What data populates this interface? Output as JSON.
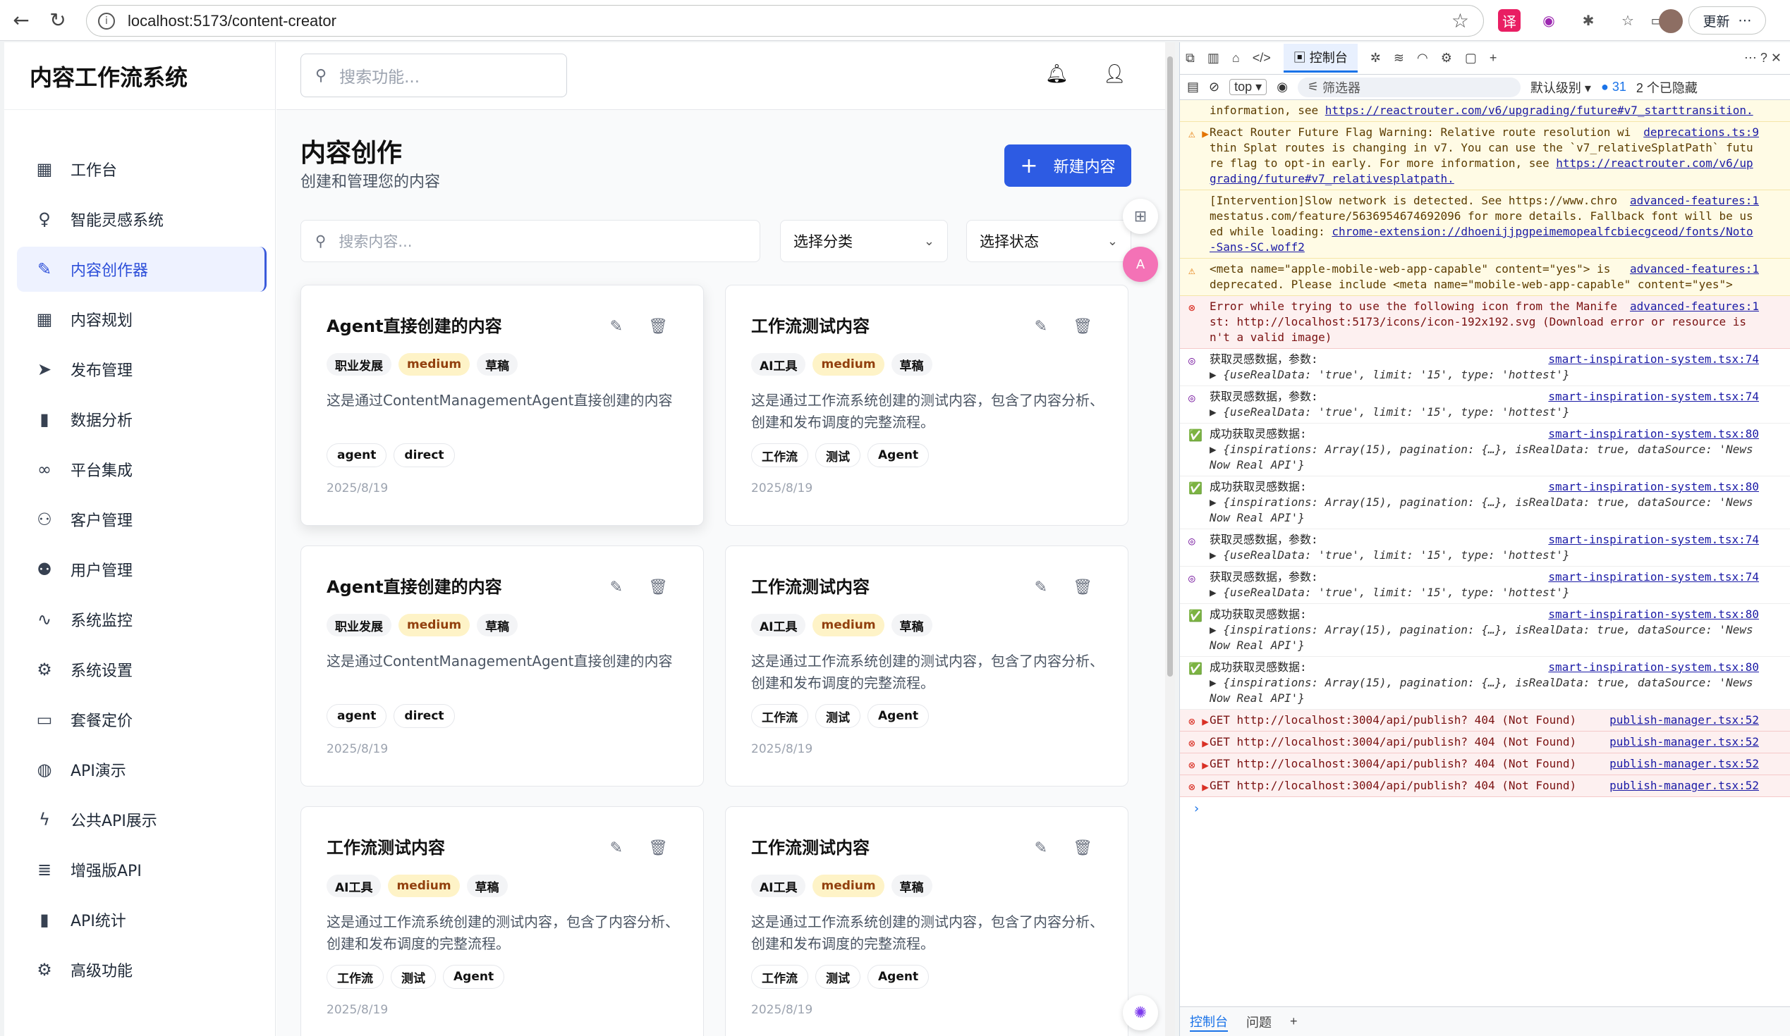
{
  "browser": {
    "url": "localhost:5173/content-creator",
    "update_label": "更新"
  },
  "app": {
    "brand": "内容工作流系统",
    "search_placeholder": "搜索功能...",
    "sidebar": [
      {
        "label": "工作台",
        "icon": "dashboard-icon"
      },
      {
        "label": "智能灵感系统",
        "icon": "lightbulb-icon"
      },
      {
        "label": "内容创作器",
        "icon": "pen-icon"
      },
      {
        "label": "内容规划",
        "icon": "calendar-icon"
      },
      {
        "label": "发布管理",
        "icon": "send-icon"
      },
      {
        "label": "数据分析",
        "icon": "bar-chart-icon"
      },
      {
        "label": "平台集成",
        "icon": "link-icon"
      },
      {
        "label": "客户管理",
        "icon": "users-icon"
      },
      {
        "label": "用户管理",
        "icon": "user-cog-icon"
      },
      {
        "label": "系统监控",
        "icon": "activity-icon"
      },
      {
        "label": "系统设置",
        "icon": "gear-icon"
      },
      {
        "label": "套餐定价",
        "icon": "credit-card-icon"
      },
      {
        "label": "API演示",
        "icon": "globe-icon"
      },
      {
        "label": "公共API展示",
        "icon": "zap-icon"
      },
      {
        "label": "增强版API",
        "icon": "database-icon"
      },
      {
        "label": "API统计",
        "icon": "bar-chart-icon"
      },
      {
        "label": "高级功能",
        "icon": "gear-icon"
      }
    ],
    "active_index": 2,
    "page_title": "内容创作",
    "page_subtitle": "创建和管理您的内容",
    "new_button": "新建内容",
    "content_search_placeholder": "搜索内容...",
    "category_select": "选择分类",
    "status_select": "选择状态",
    "cards": [
      {
        "title": "Agent直接创建的内容",
        "category": "职业发展",
        "priority": "medium",
        "status": "草稿",
        "desc": "这是通过ContentManagementAgent直接创建的内容",
        "tags": [
          "agent",
          "direct"
        ],
        "date": "2025/8/19"
      },
      {
        "title": "工作流测试内容",
        "category": "AI工具",
        "priority": "medium",
        "status": "草稿",
        "desc": "这是通过工作流系统创建的测试内容，包含了内容分析、创建和发布调度的完整流程。",
        "tags": [
          "工作流",
          "测试",
          "Agent"
        ],
        "date": "2025/8/19"
      },
      {
        "title": "Agent直接创建的内容",
        "category": "职业发展",
        "priority": "medium",
        "status": "草稿",
        "desc": "这是通过ContentManagementAgent直接创建的内容",
        "tags": [
          "agent",
          "direct"
        ],
        "date": "2025/8/19"
      },
      {
        "title": "工作流测试内容",
        "category": "AI工具",
        "priority": "medium",
        "status": "草稿",
        "desc": "这是通过工作流系统创建的测试内容，包含了内容分析、创建和发布调度的完整流程。",
        "tags": [
          "工作流",
          "测试",
          "Agent"
        ],
        "date": "2025/8/19"
      },
      {
        "title": "工作流测试内容",
        "category": "AI工具",
        "priority": "medium",
        "status": "草稿",
        "desc": "这是通过工作流系统创建的测试内容，包含了内容分析、创建和发布调度的完整流程。",
        "tags": [
          "工作流",
          "测试",
          "Agent"
        ],
        "date": "2025/8/19"
      },
      {
        "title": "工作流测试内容",
        "category": "AI工具",
        "priority": "medium",
        "status": "草稿",
        "desc": "这是通过工作流系统创建的测试内容，包含了内容分析、创建和发布调度的完整流程。",
        "tags": [
          "工作流",
          "测试",
          "Agent"
        ],
        "date": "2025/8/19"
      }
    ]
  },
  "devtools": {
    "console_tab": "控制台",
    "context": "top",
    "filter_placeholder": "筛选器",
    "level": "默认级别",
    "message_count": "31",
    "hidden_count": "2 个已隐藏",
    "bottom_tabs": [
      "控制台",
      "问题"
    ],
    "logs": [
      {
        "type": "warn",
        "icon": "",
        "src": "",
        "text": "information, see",
        "link": "https://reactrouter.com/v6/upgrading/future#v7_starttransition."
      },
      {
        "type": "warn",
        "icon": "⚠ ▶",
        "src": "deprecations.ts:9",
        "text": "React Router Future Flag Warning: Relative route resolution within Splat routes is changing in v7. You can use the `v7_relativeSplatPath` future flag to opt-in early. For more information, see",
        "link": "https://reactrouter.com/v6/upgrading/future#v7_relativesplatpath."
      },
      {
        "type": "warn",
        "icon": "",
        "src": "advanced-features:1",
        "text": "[Intervention]Slow network is detected. See https://www.chromestatus.com/feature/5636954674692096 for more details. Fallback font will be used while loading:",
        "link": "chrome-extension://dhoenijjpgpeimemopealfcbiecgceod/fonts/Noto-Sans-SC.woff2"
      },
      {
        "type": "warn",
        "icon": "⚠",
        "src": "advanced-features:1",
        "text": "<meta name=\"apple-mobile-web-app-capable\" content=\"yes\"> is deprecated. Please include <meta name=\"mobile-web-app-capable\" content=\"yes\">",
        "link": ""
      },
      {
        "type": "err",
        "icon": "⊗",
        "src": "advanced-features:1",
        "text": "Error while trying to use the following icon from the Manifest: http://localhost:5173/icons/icon-192x192.svg (Download error or resource isn't a valid image)",
        "link": ""
      },
      {
        "type": "info",
        "icon": "◎",
        "src": "smart-inspiration-system.tsx:74",
        "text": "获取灵感数据，参数:",
        "obj": "{useRealData: 'true', limit: '15', type: 'hottest'}"
      },
      {
        "type": "info",
        "icon": "◎",
        "src": "smart-inspiration-system.tsx:74",
        "text": "获取灵感数据，参数:",
        "obj": "{useRealData: 'true', limit: '15', type: 'hottest'}"
      },
      {
        "type": "info",
        "icon": "✅",
        "src": "smart-inspiration-system.tsx:80",
        "text": "成功获取灵感数据:",
        "obj": "{inspirations: Array(15), pagination: {…}, isRealData: true, dataSource: 'NewsNow Real API'}"
      },
      {
        "type": "info",
        "icon": "✅",
        "src": "smart-inspiration-system.tsx:80",
        "text": "成功获取灵感数据:",
        "obj": "{inspirations: Array(15), pagination: {…}, isRealData: true, dataSource: 'NewsNow Real API'}"
      },
      {
        "type": "info",
        "icon": "◎",
        "src": "smart-inspiration-system.tsx:74",
        "text": "获取灵感数据，参数:",
        "obj": "{useRealData: 'true', limit: '15', type: 'hottest'}"
      },
      {
        "type": "info",
        "icon": "◎",
        "src": "smart-inspiration-system.tsx:74",
        "text": "获取灵感数据，参数:",
        "obj": "{useRealData: 'true', limit: '15', type: 'hottest'}"
      },
      {
        "type": "info",
        "icon": "✅",
        "src": "smart-inspiration-system.tsx:80",
        "text": "成功获取灵感数据:",
        "obj": "{inspirations: Array(15), pagination: {…}, isRealData: true, dataSource: 'NewsNow Real API'}"
      },
      {
        "type": "info",
        "icon": "✅",
        "src": "smart-inspiration-system.tsx:80",
        "text": "成功获取灵感数据:",
        "obj": "{inspirations: Array(15), pagination: {…}, isRealData: true, dataSource: 'NewsNow Real API'}"
      },
      {
        "type": "err",
        "icon": "⊗ ▶",
        "src": "publish-manager.tsx:52",
        "text": "GET http://localhost:3004/api/publish? 404 (Not Found)",
        "link": ""
      },
      {
        "type": "err",
        "icon": "⊗ ▶",
        "src": "publish-manager.tsx:52",
        "text": "GET http://localhost:3004/api/publish? 404 (Not Found)",
        "link": ""
      },
      {
        "type": "err",
        "icon": "⊗ ▶",
        "src": "publish-manager.tsx:52",
        "text": "GET http://localhost:3004/api/publish? 404 (Not Found)",
        "link": ""
      },
      {
        "type": "err",
        "icon": "⊗ ▶",
        "src": "publish-manager.tsx:52",
        "text": "GET http://localhost:3004/api/publish? 404 (Not Found)",
        "link": ""
      }
    ]
  }
}
